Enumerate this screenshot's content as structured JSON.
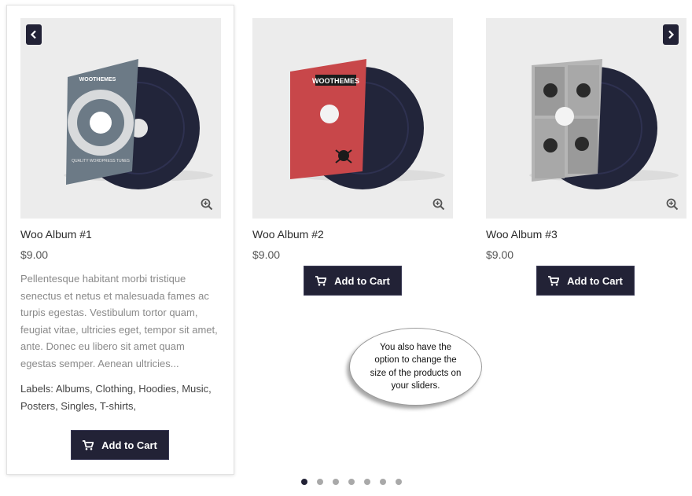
{
  "slider": {
    "prev_icon": "chevron-left-icon",
    "next_icon": "chevron-right-icon",
    "accent_color": "#222236",
    "dot_count": 7,
    "active_dot": 1
  },
  "products": [
    {
      "title": "Woo Album #1",
      "price": "$9.00",
      "description": "Pellentesque habitant morbi tristique senectus et netus et malesuada fames ac turpis egestas. Vestibulum tortor quam, feugiat vitae, ultricies eget, tempor sit amet, ante. Donec eu libero sit amet quam egestas semper. Aenean ultricies...",
      "labels": "Labels: Albums, Clothing, Hoodies, Music, Posters, Singles, T-shirts,",
      "button": "Add to Cart",
      "cover_color": "#6c7a86",
      "cover_text": "WOOTHEMES",
      "cover_ring_text": "QUALITY WORDPRESS TUNES"
    },
    {
      "title": "Woo Album #2",
      "price": "$9.00",
      "button": "Add to Cart",
      "cover_color": "#c8474a",
      "cover_text": "WOOTHEMES"
    },
    {
      "title": "Woo Album #3",
      "price": "$9.00",
      "button": "Add to Cart",
      "cover_color": "#b5b5b5"
    }
  ],
  "callout": {
    "text": "You also have the option to change the size of the products on your sliders."
  }
}
